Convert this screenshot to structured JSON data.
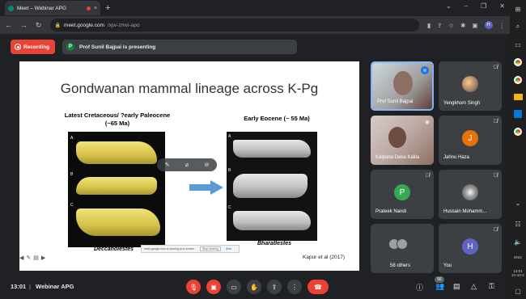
{
  "browser": {
    "tab_title": "Meet – Webinar APG",
    "tab_close": "×",
    "new_tab": "+",
    "url_domain": "meet.google.com",
    "url_path": "/xjw-zmvi-apo",
    "profile_letter": "H"
  },
  "meet": {
    "recording_label": "Recording",
    "presenter_initial": "P",
    "presenter_text": "Prof Sunil Bajpai is presenting",
    "time": "13:01",
    "separator": "|",
    "meeting_name": "Webinar APG",
    "participant_count": "56"
  },
  "slide": {
    "title": "Gondwanan mammal lineage across K-Pg",
    "left_heading": "Latest Cretaceous/ ?early Paleocene",
    "left_subheading": "(~65 Ma)",
    "right_heading": "Early Eocene (~ 55 Ma)",
    "left_caption": "Deccanolestes",
    "right_caption": "Bharatlestes",
    "credit": "Kapur et al (2017)",
    "fig_labels_left": [
      "A",
      "B",
      "C"
    ],
    "fig_labels_right": [
      "A",
      "B",
      "C"
    ],
    "share_notice": "meet.google.com is sharing your screen.",
    "share_stop": "Stop sharing",
    "share_hide": "Hide"
  },
  "participants": [
    {
      "name": "Prof Sunil Bajpai",
      "type": "photo"
    },
    {
      "name": "Yengkhom Singh",
      "type": "small-photo"
    },
    {
      "name": "Kalpana Deka Kalita",
      "type": "photo"
    },
    {
      "name": "Jahnu Haza",
      "type": "avatar",
      "initial": "J",
      "color": "#e8710a"
    },
    {
      "name": "Prateek Nandi",
      "type": "avatar",
      "initial": "P",
      "color": "#34a853"
    },
    {
      "name": "Hussain Mohamm...",
      "type": "small-photo"
    },
    {
      "name": "58 others",
      "type": "others"
    },
    {
      "name": "You",
      "type": "avatar",
      "initial": "H",
      "color": "#5f63c7"
    }
  ],
  "taskbar": {
    "clock_time": "13:01",
    "clock_date": "21-10-2",
    "lang": "ENG"
  },
  "colors": {
    "meet_bg": "#202124",
    "tile_bg": "#3c4043",
    "recording_red": "#ea4335",
    "speaking_blue": "#1a73e8"
  }
}
